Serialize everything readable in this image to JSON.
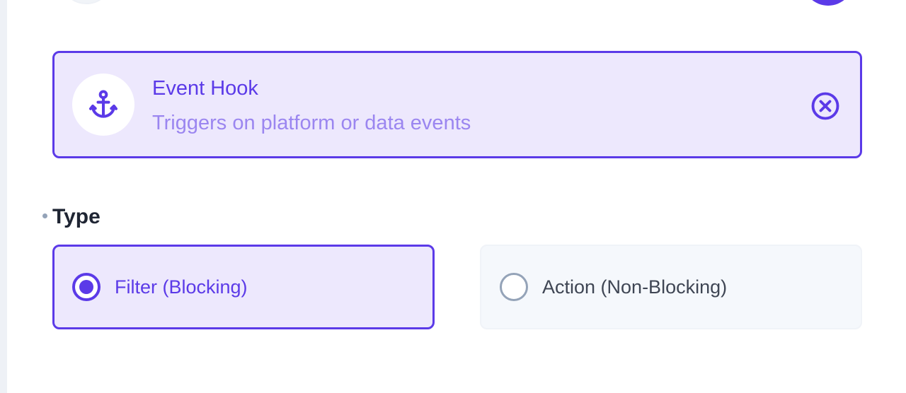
{
  "hook": {
    "title": "Event Hook",
    "subtitle": "Triggers on platform or data events",
    "icon": "anchor-icon",
    "close_icon": "close-circle-icon"
  },
  "type_section": {
    "label": "Type",
    "options": [
      {
        "label": "Filter (Blocking)",
        "selected": true
      },
      {
        "label": "Action (Non-Blocking)",
        "selected": false
      }
    ]
  },
  "colors": {
    "accent": "#5b3ae8",
    "accent_light": "#ede8fd",
    "muted_accent": "#9b86f0",
    "neutral_radio": "#94a3b8"
  }
}
